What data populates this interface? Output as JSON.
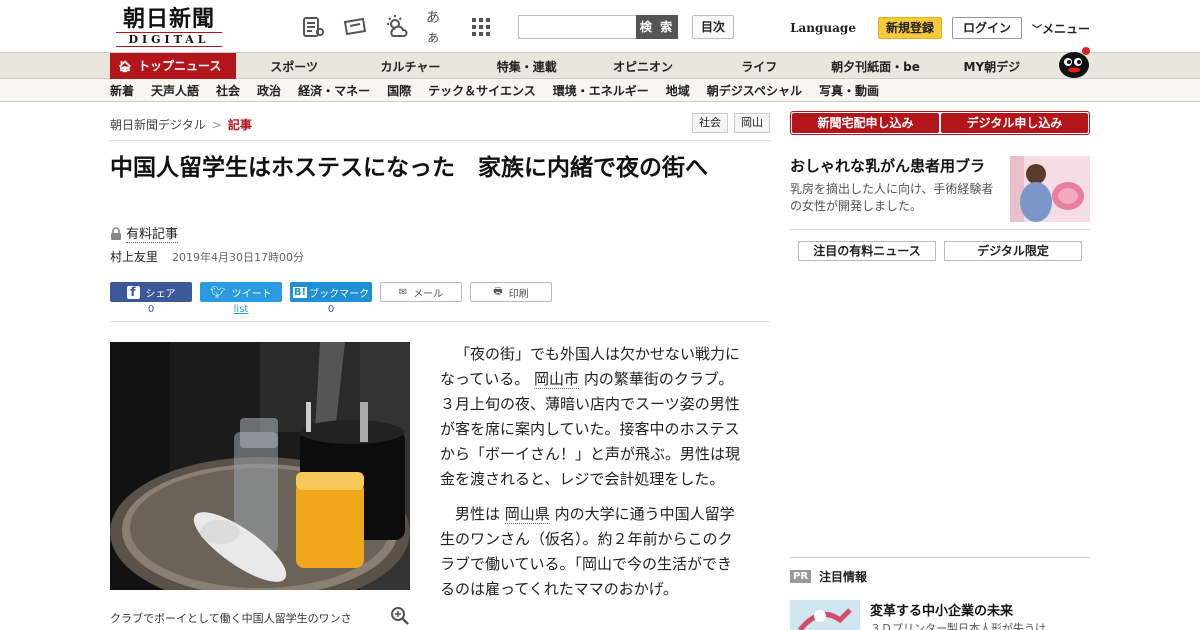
{
  "header": {
    "logo_main": "朝日新聞",
    "logo_sub": "DIGITAL",
    "search_button": "検 索",
    "toc_button": "目次",
    "language": "Language",
    "register": "新規登録",
    "login": "ログイン",
    "menu": "メニュー",
    "icon_aa": "あぁ"
  },
  "nav1": [
    "トップニュース",
    "スポーツ",
    "カルチャー",
    "特集・連載",
    "オピニオン",
    "ライフ",
    "朝夕刊紙面・be",
    "MY朝デジ"
  ],
  "nav2": [
    "新着",
    "天声人語",
    "社会",
    "政治",
    "経済・マネー",
    "国際",
    "テック＆サイエンス",
    "環境・エネルギー",
    "地域",
    "朝デジスペシャル",
    "写真・動画"
  ],
  "breadcrumb": {
    "home": "朝日新聞デジタル",
    "sep": ">",
    "current": "記事"
  },
  "tags": [
    "社会",
    "岡山"
  ],
  "article": {
    "title": "中国人留学生はホステスになった　家族に内緒で夜の街へ",
    "paid": "有料記事",
    "author": "村上友里",
    "date": "2019年4月30日17時00分",
    "share": {
      "facebook": "シェア",
      "facebook_count": "0",
      "twitter": "ツイート",
      "twitter_count": "list",
      "hatena": "ブックマーク",
      "hatena_count": "0",
      "mail": "メール",
      "print": "印刷"
    },
    "caption": "クラブでボーイとして働く中国人留学生のワンさ",
    "p1_a": "「夜の街」でも外国人は欠かせない戦力になっている。",
    "p1_link": "岡山市",
    "p1_b": "内の繁華街のクラブ。３月上旬の夜、薄暗い店内でスーツ姿の男性が客を席に案内していた。接客中のホステスから「ボーイさん！」と声が飛ぶ。男性は現金を渡されると、レジで会計処理をした。",
    "p2_a": "男性は",
    "p2_link": "岡山県",
    "p2_b": "内の大学に通う中国人留学生のワンさん（仮名）。約２年前からこのクラブで働いている。「岡山で今の生活ができるのは雇ってくれたママのおかげ。"
  },
  "sidebar": {
    "subscribe_paper": "新聞宅配申し込み",
    "subscribe_digital": "デジタル申し込み",
    "promo_title": "おしゃれな乳がん患者用ブラ",
    "promo_desc": "乳房を摘出した人に向け、手術経験者の女性が開発しました。",
    "tab1": "注目の有料ニュース",
    "tab2": "デジタル限定",
    "pr_badge": "PR",
    "pr_head": "注目情報",
    "pr_title": "変革する中小企業の未来",
    "pr_desc": "３Ｄプリンター製日本人形が失うけ"
  }
}
